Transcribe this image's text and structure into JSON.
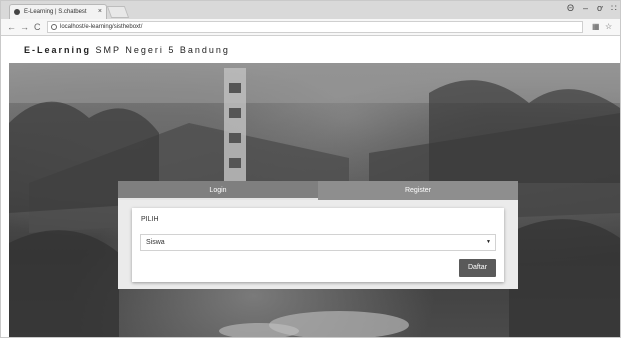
{
  "browser": {
    "tab_title": "E-Learning | S.chatbest",
    "tab_close": "×",
    "url": "localhost/e-learning/sistheboxt/",
    "back": "←",
    "forward": "→",
    "reload": "C",
    "window_controls": {
      "profile": "Θ",
      "minimize": "–",
      "maximize": "ơ",
      "close": "∷"
    },
    "toolbar_icons": {
      "extensions": "▦",
      "bookmark": "☆"
    }
  },
  "header": {
    "brand_strong": "E-Learning",
    "brand_rest": "SMP Negeri 5 Bandung"
  },
  "auth_panel": {
    "tabs": [
      "Login",
      "Register"
    ],
    "active_tab": "Login",
    "form": {
      "label": "PILIH",
      "select_value": "Siswa",
      "select_caret": "▼",
      "submit_label": "Daftar"
    }
  }
}
